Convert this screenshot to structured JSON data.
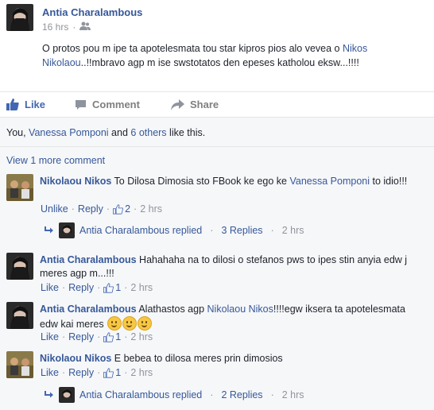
{
  "post": {
    "author": "Antia Charalambous",
    "time": "16 hrs",
    "privacy_icon": "friends-icon",
    "text_plain": "O protos pou m ipe ta apotelesmata tou star kipros pios alo vevea o ",
    "text_link": "Nikos Nikolaou",
    "text_after": "..!!mbravo agp m ise swstotatos den epeses katholou eksw...!!!!"
  },
  "actions": {
    "like": "Like",
    "comment": "Comment",
    "share": "Share"
  },
  "likes_summary": {
    "prefix": "You, ",
    "name": "Vanessa Pomponi",
    "and": " and ",
    "others": "6 others",
    "suffix": " like this."
  },
  "view_more": "View 1 more comment",
  "comments": [
    {
      "author": "Nikolaou Nikos",
      "text1": " To Dilosa Dimosia sto FBook ke ego ke ",
      "link": "Vanessa Pomponi",
      "text2": " to idio!!!",
      "unlike": "Unlike",
      "reply": "Reply",
      "likes": "2",
      "time": "2 hrs",
      "replied": {
        "name": "Antia Charalambous",
        "label": " replied",
        "count": "3 Replies",
        "time": "2 hrs"
      }
    },
    {
      "author": "Antia Charalambous",
      "text": " Hahahaha na to dilosi o stefanos pws to ipes stin anyia edw j meres agp m...!!!",
      "like": "Like",
      "reply": "Reply",
      "likes": "1",
      "time": "2 hrs"
    },
    {
      "author": "Antia Charalambous",
      "text1": " Alathastos agp ",
      "link": "Nikolaou Nikos",
      "text2": "!!!!egw iksera ta apotelesmata edw kai meres ",
      "like": "Like",
      "reply": "Reply",
      "likes": "1",
      "time": "2 hrs"
    },
    {
      "author": "Nikolaou Nikos",
      "text": " E bebea to dilosa meres prin dimosios",
      "like": "Like",
      "reply": "Reply",
      "likes": "1",
      "time": "2 hrs",
      "replied": {
        "name": "Antia Charalambous",
        "label": " replied",
        "count": "2 Replies",
        "time": "2 hrs"
      }
    }
  ],
  "colors": {
    "link": "#365899",
    "meta": "#90949c",
    "like_blue": "#4267b2"
  }
}
